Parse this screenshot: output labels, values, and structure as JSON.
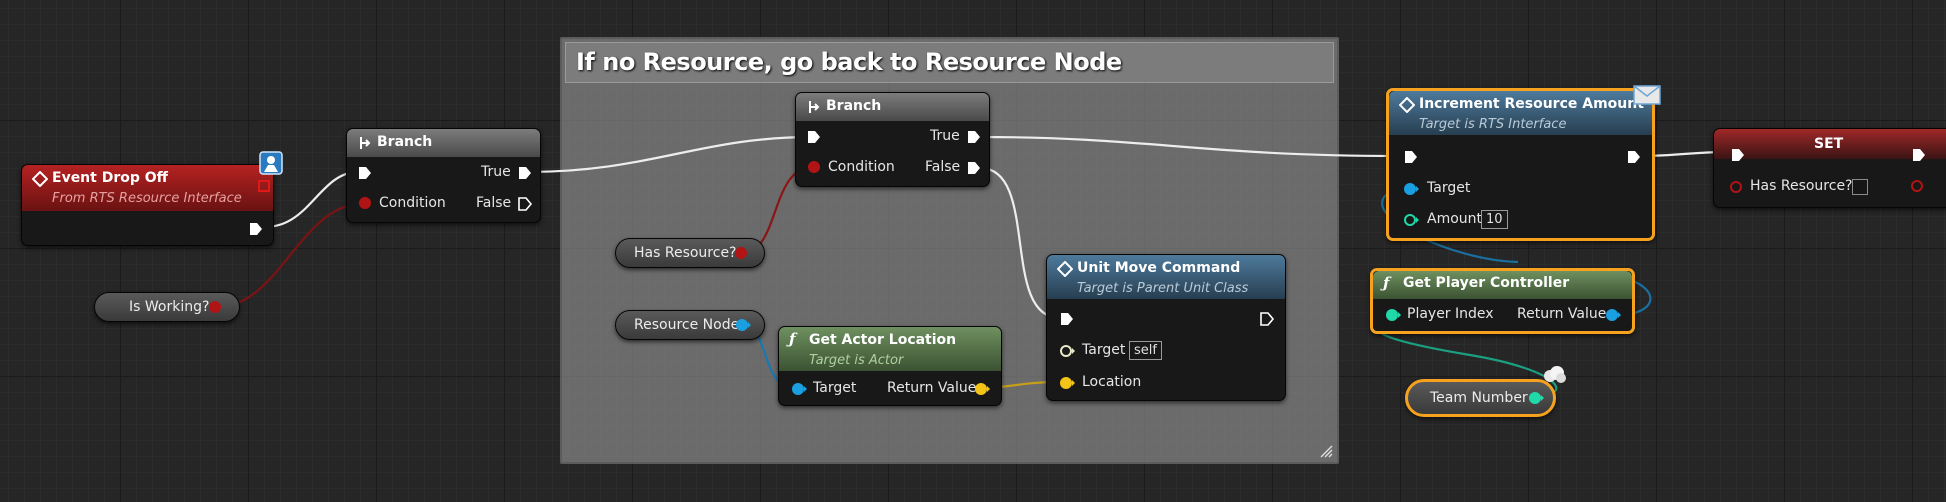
{
  "comment": {
    "title": "If no Resource, go back to Resource Node"
  },
  "nodes": {
    "event_drop_off": {
      "title": "Event Drop Off",
      "subtitle": "From RTS Resource Interface"
    },
    "branch1": {
      "title": "Branch",
      "true_label": "True",
      "false_label": "False",
      "condition_label": "Condition"
    },
    "branch2": {
      "title": "Branch",
      "true_label": "True",
      "false_label": "False",
      "condition_label": "Condition"
    },
    "unit_move": {
      "title": "Unit Move Command",
      "subtitle": "Target is Parent Unit Class",
      "target_label": "Target",
      "target_value": "self",
      "location_label": "Location"
    },
    "get_actor_location": {
      "title": "Get Actor Location",
      "subtitle": "Target is Actor",
      "target_label": "Target",
      "return_label": "Return Value"
    },
    "increment": {
      "title": "Increment Resource Amount",
      "subtitle": "Target is RTS Interface",
      "target_label": "Target",
      "amount_label": "Amount",
      "amount_value": "10"
    },
    "get_player_controller": {
      "title": "Get Player Controller",
      "player_index_label": "Player Index",
      "return_label": "Return Value"
    },
    "set": {
      "title": "SET",
      "has_resource_label": "Has Resource?"
    }
  },
  "variables": {
    "is_working": "Is Working?",
    "has_resource": "Has Resource?",
    "resource_node": "Resource Node",
    "team_number": "Team Number"
  },
  "colors": {
    "event_header": "#a82020",
    "branch_header": "#6c6c6c",
    "function_header_blue": "#3e6a8a",
    "pure_header_green": "#5a7a4e",
    "set_header": "#8c2424",
    "bool_pin": "#b01414",
    "object_pin": "#1aa0e0",
    "vector_pin": "#f3c318",
    "int_pin": "#20d8a8",
    "selection": "#f7a21e"
  }
}
